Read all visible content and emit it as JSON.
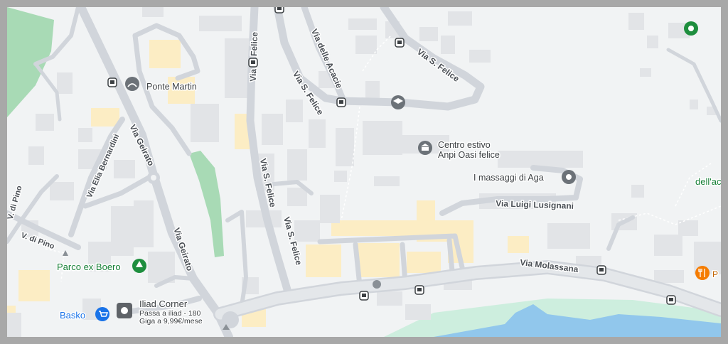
{
  "streets": {
    "via_s_felice_1": "Via S. Felice",
    "via_s_felice_2": "Via S. Felice",
    "via_s_felice_3": "Via S. Felice",
    "via_s_felice_4": "Via S. Felice",
    "via_s_felice_5": "Via S. Felice",
    "via_delle_acacie": "Via delle Acacie",
    "via_geirato_1": "Via Geirato",
    "via_geirato_2": "Via Geirato",
    "via_elia_bernardini": "Via Elia Bernardini",
    "via_di_pino_1": "V. di Pino",
    "via_di_pino_2": "V. di Pino",
    "via_luigi_lusignani": "Via Luigi Lusignani",
    "via_molassana": "Via Molassana"
  },
  "places": {
    "ponte_martin": "Ponte Martin",
    "centro_estivo_line1": "Centro estivo",
    "centro_estivo_line2": "Anpi Oasi felice",
    "massaggi": "I massaggi di Aga",
    "parco_ex_boero": "Parco ex Boero",
    "basko": "Basko",
    "iliad_title": "Iliad Corner",
    "iliad_sub1": "Passa a iliad - 180",
    "iliad_sub2": "Giga a 9,99€/mese",
    "dell_a": "dell'ac"
  },
  "colors": {
    "background": "#f1f3f4",
    "road": "#d1d5db",
    "building": "#e2e4e7",
    "building_yellow": "#fcedc4",
    "park": "#a8dab5",
    "river": "#91c7ec",
    "riverbank": "#cdeede",
    "transit_icon": "#3c4043",
    "pin_gray": "#6c7278",
    "pin_green": "#1e8e3e",
    "pin_blue": "#1a73e8",
    "pin_orange": "#f57c00"
  },
  "icons": [
    "bus-stop-icon",
    "graduation-cap-icon",
    "museum-icon",
    "spa-pin-icon",
    "tree-icon",
    "shopping-cart-icon",
    "store-icon",
    "restaurant-icon",
    "bridge-icon"
  ]
}
